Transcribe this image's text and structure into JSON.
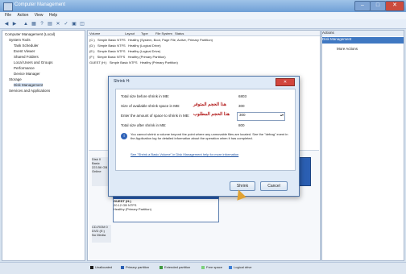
{
  "window": {
    "title": "Computer Management"
  },
  "menu": [
    "File",
    "Action",
    "View",
    "Help"
  ],
  "tree": [
    "Computer Management (Local)",
    "System Tools",
    "Task Scheduler",
    "Event Viewer",
    "Shared Folders",
    "Local Users and Groups",
    "Performance",
    "Device Manager",
    "Storage",
    "Disk Management",
    "Services and Applications"
  ],
  "columns": [
    "Volume",
    "Layout",
    "Type",
    "File System",
    "Status"
  ],
  "volumes": [
    [
      "(C:)",
      "Simple",
      "Basic",
      "NTFS",
      "Healthy (System, Boot, Page File, Active, Primary Partition)"
    ],
    [
      "(D:)",
      "Simple",
      "Basic",
      "NTFS",
      "Healthy (Logical Drive)"
    ],
    [
      "(E:)",
      "Simple",
      "Basic",
      "NTFS",
      "Healthy (Logical Drive)"
    ],
    [
      "(F:)",
      "Simple",
      "Basic",
      "NTFS",
      "Healthy (Primary Partition)"
    ],
    [
      "GUEST (H:)",
      "Simple",
      "Basic",
      "NTFS",
      "Healthy (Primary Partition)"
    ]
  ],
  "actions": {
    "header": "Actions",
    "selected": "Disk Management",
    "more": "More Actions"
  },
  "dialog": {
    "title": "Shrink H:",
    "rows": [
      {
        "label": "Total size before shrink in MB:",
        "value": "6803"
      },
      {
        "label": "Size of available shrink space in MB:",
        "value": "300"
      },
      {
        "label": "Enter the amount of space to shrink in MB:",
        "value": "300"
      },
      {
        "label": "Total size after shrink in MB:",
        "value": "800"
      }
    ],
    "note": "You cannot shrink a volume beyond the point where any unmovable files are located. See the \"defrag\" event in the Application log for detailed information about the operation when it has completed.",
    "help_link": "See \"Shrink a Basic Volume\" in Disk Management help for more information",
    "annotation_available": "هذا الحجم المتوفر",
    "annotation_requested": "هذا الحجم المطلوب",
    "shrink_button": "Shrink",
    "cancel_button": "Cancel"
  },
  "disk_panel": {
    "disk_label": "Disk 0",
    "disk_type": "Basic",
    "disk_size": "223.56 GB",
    "disk_status": "Online",
    "volume_name": "GUEST (H:)",
    "volume_size": "20.12 GB NTFS",
    "volume_status": "Healthy (Primary Partition)",
    "cd_label": "CD-ROM 0",
    "cd_type": "DVD (E:)",
    "cd_status": "No Media"
  },
  "legend": [
    "Unallocated",
    "Primary partition",
    "Extended partition",
    "Free space",
    "Logical drive"
  ],
  "colors": {
    "unallocated": "#1c1c1c",
    "primary": "#2b5fb3",
    "extended": "#3f9a3f",
    "free": "#7cd07c",
    "logical": "#3d7fd6",
    "dialog_close": "#d2463d",
    "annotation": "#b01515"
  }
}
